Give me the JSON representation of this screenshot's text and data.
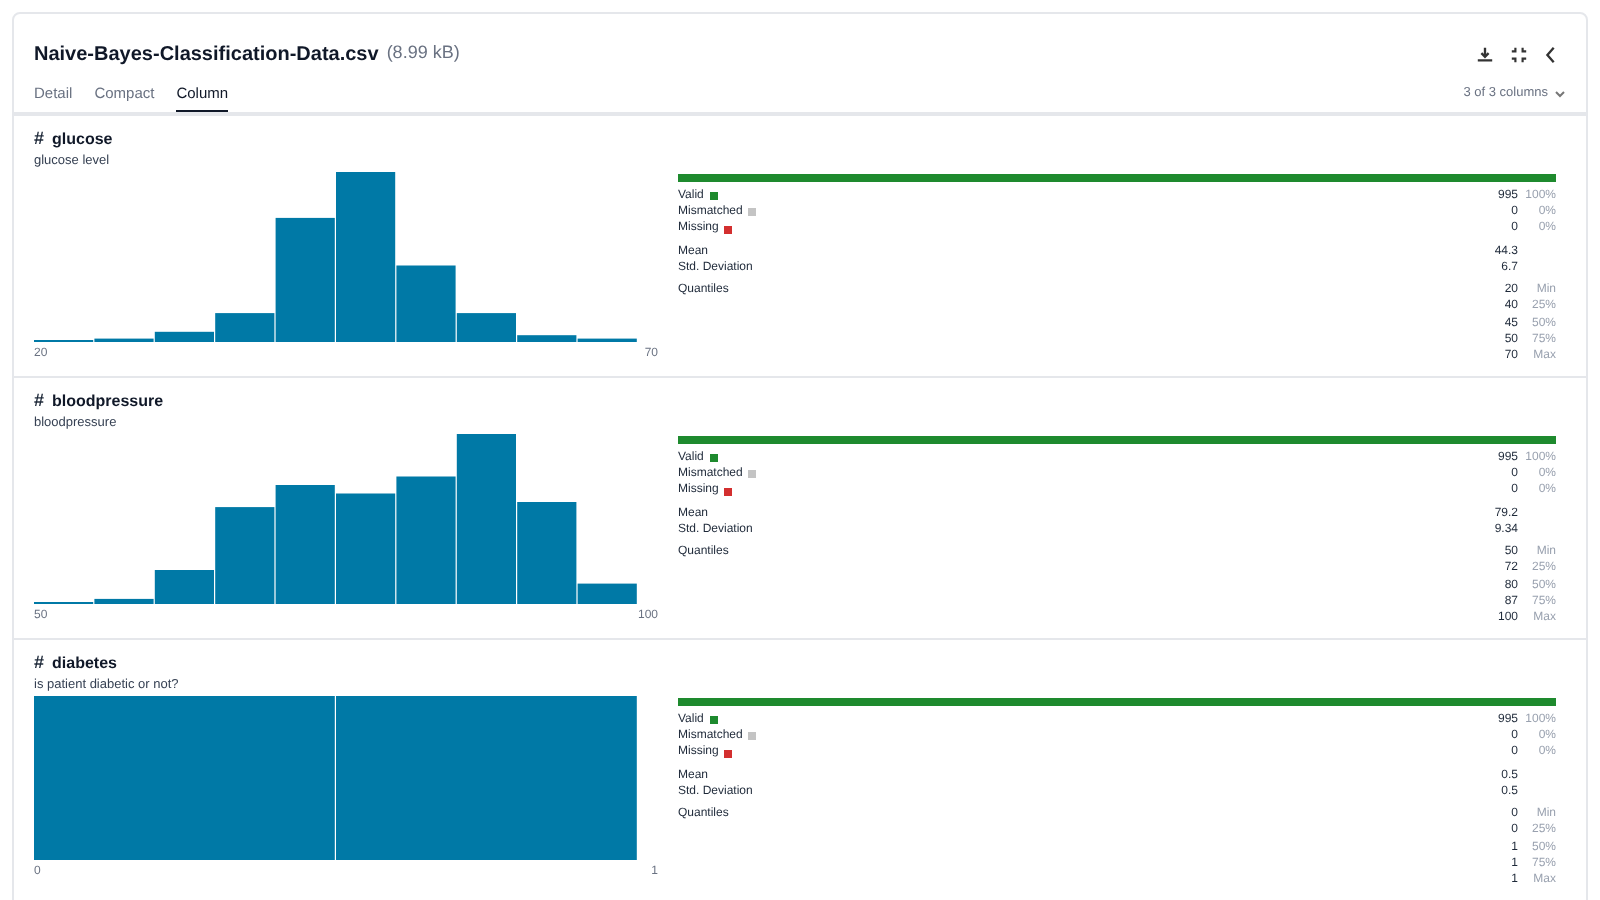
{
  "file": {
    "name": "Naive-Bayes-Classification-Data.csv",
    "size": "(8.99 kB)"
  },
  "tabs": [
    {
      "label": "Detail",
      "selected": false
    },
    {
      "label": "Compact",
      "selected": false
    },
    {
      "label": "Column",
      "selected": true
    }
  ],
  "column_picker": {
    "label": "3 of 3 columns"
  },
  "columns": [
    {
      "type_icon": "#",
      "name": "glucose",
      "description": "glucose level",
      "histogram": {
        "min": "20",
        "max": "70"
      },
      "bar": {
        "level": 1
      },
      "validity": [
        {
          "label": "Valid",
          "color": "#1e8a2e",
          "count": "995",
          "pct": "100%"
        },
        {
          "label": "Mismatched",
          "color": "#c4c4c4",
          "count": "0",
          "pct": "0%"
        },
        {
          "label": "Missing",
          "color": "#d32f2f",
          "count": "0",
          "pct": "0%"
        }
      ],
      "stats": [
        {
          "label": "Mean",
          "value": "44.3"
        },
        {
          "label": "Std. Deviation",
          "value": "6.7"
        }
      ],
      "quantiles_label": "Quantiles",
      "quantiles": [
        {
          "value": "20",
          "label": "Min"
        },
        {
          "value": "40",
          "label": "25%"
        },
        {
          "value": "45",
          "label": "50%"
        },
        {
          "value": "50",
          "label": "75%"
        },
        {
          "value": "70",
          "label": "Max"
        }
      ]
    },
    {
      "type_icon": "#",
      "name": "bloodpressure",
      "description": "bloodpressure",
      "histogram": {
        "min": "50",
        "max": "100"
      },
      "bar": {
        "level": 1
      },
      "validity": [
        {
          "label": "Valid",
          "color": "#1e8a2e",
          "count": "995",
          "pct": "100%"
        },
        {
          "label": "Mismatched",
          "color": "#c4c4c4",
          "count": "0",
          "pct": "0%"
        },
        {
          "label": "Missing",
          "color": "#d32f2f",
          "count": "0",
          "pct": "0%"
        }
      ],
      "stats": [
        {
          "label": "Mean",
          "value": "79.2"
        },
        {
          "label": "Std. Deviation",
          "value": "9.34"
        }
      ],
      "quantiles_label": "Quantiles",
      "quantiles": [
        {
          "value": "50",
          "label": "Min"
        },
        {
          "value": "72",
          "label": "25%"
        },
        {
          "value": "80",
          "label": "50%"
        },
        {
          "value": "87",
          "label": "75%"
        },
        {
          "value": "100",
          "label": "Max"
        }
      ]
    },
    {
      "type_icon": "#",
      "name": "diabetes",
      "description": "is patient diabetic or not?",
      "histogram": {
        "min": "0",
        "max": "1"
      },
      "bar": {
        "level": 1
      },
      "validity": [
        {
          "label": "Valid",
          "color": "#1e8a2e",
          "count": "995",
          "pct": "100%"
        },
        {
          "label": "Mismatched",
          "color": "#c4c4c4",
          "count": "0",
          "pct": "0%"
        },
        {
          "label": "Missing",
          "color": "#d32f2f",
          "count": "0",
          "pct": "0%"
        }
      ],
      "stats": [
        {
          "label": "Mean",
          "value": "0.5"
        },
        {
          "label": "Std. Deviation",
          "value": "0.5"
        }
      ],
      "quantiles_label": "Quantiles",
      "quantiles": [
        {
          "value": "0",
          "label": "Min"
        },
        {
          "value": "0",
          "label": "25%"
        },
        {
          "value": "1",
          "label": "50%"
        },
        {
          "value": "1",
          "label": "75%"
        },
        {
          "value": "1",
          "label": "Max"
        }
      ]
    }
  ]
}
